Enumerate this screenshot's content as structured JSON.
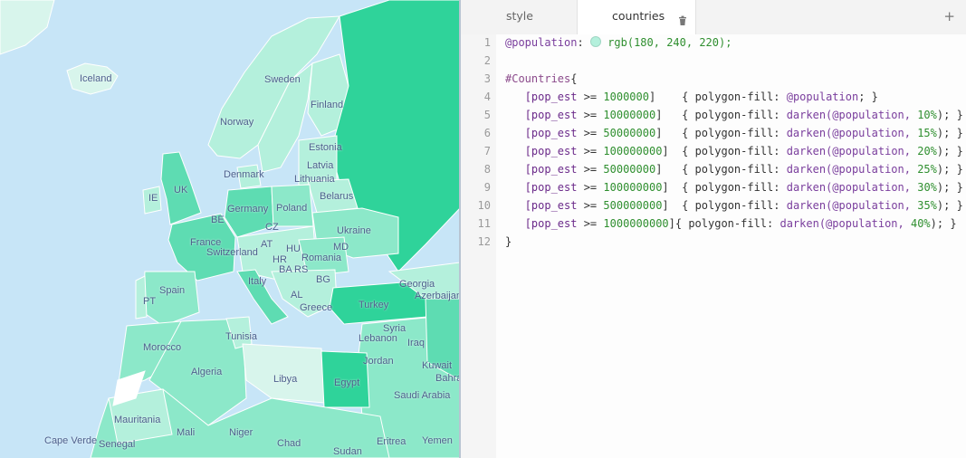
{
  "map": {
    "labels": [
      "Iceland",
      "Sweden",
      "Norway",
      "Finland",
      "Estonia",
      "Latvia",
      "Denmark",
      "Lithuania",
      "IE",
      "UK",
      "Belarus",
      "Germany",
      "Poland",
      "BE",
      "CZ",
      "Ukraine",
      "France",
      "AT",
      "HU",
      "MD",
      "Switzerland",
      "Romania",
      "HR",
      "BA",
      "RS",
      "Spain",
      "Italy",
      "BG",
      "PT",
      "AL",
      "Georgia",
      "Azerbaijan",
      "Greece",
      "Turkey",
      "Syria",
      "Tunisia",
      "Morocco",
      "Lebanon",
      "Iraq",
      "Jordan",
      "Algeria",
      "Libya",
      "Kuwait",
      "Bahra",
      "Egypt",
      "Saudi Arabia",
      "Mauritania",
      "Mali",
      "Niger",
      "Cape Verde",
      "Chad",
      "Senegal",
      "Eritrea",
      "Yemen",
      "Sudan"
    ]
  },
  "colors": {
    "water": "#c7e5f7",
    "land_light": "#d8f5ec",
    "pop_1m": "#b4f0dc",
    "pop_10m": "#8ce8c9",
    "pop_50m": "#5edcb2",
    "pop_100m": "#2fd39a",
    "label": "#4c5f8c"
  },
  "tabs": [
    {
      "label": "style"
    },
    {
      "label": "countries"
    }
  ],
  "editor": {
    "add_tab_label": "+",
    "line_numbers": [
      "1",
      "2",
      "3",
      "4",
      "5",
      "6",
      "7",
      "8",
      "9",
      "10",
      "11",
      "12"
    ],
    "line1": {
      "var": "@population",
      "colon": ":",
      "value": "rgb(180, 240, 220);"
    },
    "line3": {
      "selector": "#Countries",
      "brace": "{"
    },
    "filters": [
      {
        "field": "[pop_est",
        "op": " >= ",
        "num": "1000000",
        "close": "]",
        "pad": "   ",
        "rule": "{ polygon-fill: ",
        "fn": "@population",
        "arg": "",
        "end": "; }"
      },
      {
        "field": "[pop_est",
        "op": " >= ",
        "num": "10000000",
        "close": "]",
        "pad": "  ",
        "rule": "{ polygon-fill: ",
        "fn": "darken(@population, ",
        "arg": "10%",
        "end": "); }"
      },
      {
        "field": "[pop_est",
        "op": " >= ",
        "num": "50000000",
        "close": "]",
        "pad": "  ",
        "rule": "{ polygon-fill: ",
        "fn": "darken(@population, ",
        "arg": "15%",
        "end": "); }"
      },
      {
        "field": "[pop_est",
        "op": " >= ",
        "num": "100000000",
        "close": "]",
        "pad": " ",
        "rule": "{ polygon-fill: ",
        "fn": "darken(@population, ",
        "arg": "20%",
        "end": "); }"
      },
      {
        "field": "[pop_est",
        "op": " >= ",
        "num": "50000000",
        "close": "]",
        "pad": "  ",
        "rule": "{ polygon-fill: ",
        "fn": "darken(@population, ",
        "arg": "25%",
        "end": "); }"
      },
      {
        "field": "[pop_est",
        "op": " >= ",
        "num": "100000000",
        "close": "]",
        "pad": " ",
        "rule": "{ polygon-fill: ",
        "fn": "darken(@population, ",
        "arg": "30%",
        "end": "); }"
      },
      {
        "field": "[pop_est",
        "op": " >= ",
        "num": "500000000",
        "close": "]",
        "pad": " ",
        "rule": "{ polygon-fill: ",
        "fn": "darken(@population, ",
        "arg": "35%",
        "end": "); }"
      },
      {
        "field": "[pop_est",
        "op": " >= ",
        "num": "1000000000",
        "close": "]",
        "pad": "",
        "rule": "{ polygon-fill: ",
        "fn": "darken(@population, ",
        "arg": "40%",
        "end": "); }"
      }
    ],
    "line12": "}"
  }
}
